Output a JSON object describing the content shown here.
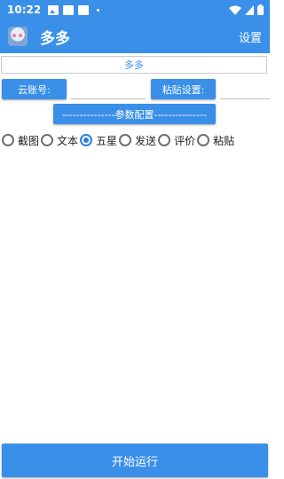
{
  "status_bar": {
    "time": "10:22"
  },
  "app_bar": {
    "title": "多多",
    "action": "设置"
  },
  "title_field": {
    "value": "多多"
  },
  "cloud_account": {
    "label": "云账号:",
    "value": ""
  },
  "paste_setting": {
    "label": "粘贴设置:",
    "value": ""
  },
  "config_button": {
    "label": "---------------参数配置---------------"
  },
  "radio_options": [
    {
      "label": "截图",
      "checked": false
    },
    {
      "label": "文本",
      "checked": false
    },
    {
      "label": "五星",
      "checked": true
    },
    {
      "label": "发送",
      "checked": false
    },
    {
      "label": "评价",
      "checked": false
    },
    {
      "label": "粘贴",
      "checked": false
    }
  ],
  "run_button": {
    "label": "开始运行"
  },
  "colors": {
    "primary": "#3a8fe8",
    "radio_checked": "#2d7fe0"
  }
}
